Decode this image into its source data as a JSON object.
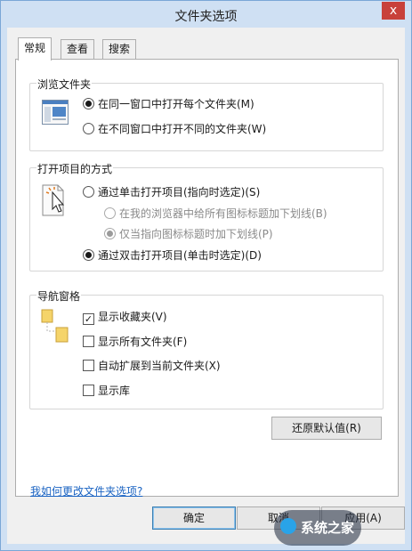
{
  "window": {
    "title": "文件夹选项",
    "close": "x"
  },
  "tabs": [
    {
      "label": "常规",
      "active": true
    },
    {
      "label": "查看",
      "active": false
    },
    {
      "label": "搜索",
      "active": false
    }
  ],
  "browse_group": {
    "title": "浏览文件夹",
    "options": [
      {
        "label": "在同一窗口中打开每个文件夹(M)",
        "selected": true
      },
      {
        "label": "在不同窗口中打开不同的文件夹(W)",
        "selected": false
      }
    ]
  },
  "click_group": {
    "title": "打开项目的方式",
    "single_click": "通过单击打开项目(指向时选定)(S)",
    "sub_options": [
      {
        "label": "在我的浏览器中给所有图标标题加下划线(B)",
        "selected": false,
        "disabled": true
      },
      {
        "label": "仅当指向图标标题时加下划线(P)",
        "selected": true,
        "disabled": true
      }
    ],
    "double_click": "通过双击打开项目(单击时选定)(D)"
  },
  "nav_group": {
    "title": "导航窗格",
    "checks": [
      {
        "label": "显示收藏夹(V)",
        "checked": true
      },
      {
        "label": "显示所有文件夹(F)",
        "checked": false
      },
      {
        "label": "自动扩展到当前文件夹(X)",
        "checked": false
      },
      {
        "label": "显示库",
        "checked": false
      }
    ]
  },
  "restore_button": "还原默认值(R)",
  "help_link": "我如何更改文件夹选项?",
  "footer": {
    "ok": "确定",
    "cancel": "取消",
    "apply": "应用(A)"
  },
  "watermark": "系统之家"
}
